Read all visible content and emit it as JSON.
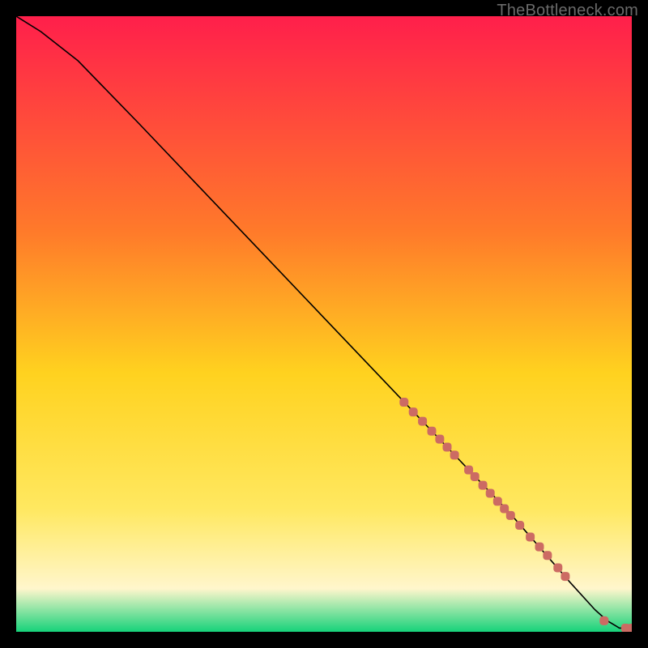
{
  "watermark": "TheBottleneck.com",
  "colors": {
    "background": "#000000",
    "gradient_top": "#ff1f4b",
    "gradient_mid_upper": "#ff7a2a",
    "gradient_mid": "#ffd21f",
    "gradient_mid_lower": "#ffe860",
    "gradient_pale": "#fff6cc",
    "gradient_bottom": "#16d27a",
    "curve": "#000000",
    "marker_fill": "#cc6b63",
    "marker_stroke": "#cc6b63"
  },
  "chart_data": {
    "type": "line",
    "title": "",
    "xlabel": "",
    "ylabel": "",
    "xlim": [
      0,
      100
    ],
    "ylim": [
      0,
      100
    ],
    "grid": false,
    "legend": false,
    "series": [
      {
        "name": "curve",
        "kind": "line",
        "x": [
          0,
          4,
          10,
          20,
          30,
          40,
          50,
          60,
          70,
          80,
          90,
          94,
          96,
          98,
          100
        ],
        "y": [
          100,
          97.5,
          92.8,
          82.5,
          72.0,
          61.5,
          51.0,
          40.5,
          30.0,
          19.5,
          8.0,
          3.6,
          1.8,
          0.6,
          0.6
        ]
      },
      {
        "name": "markers",
        "kind": "scatter",
        "x": [
          63,
          64.5,
          66,
          67.5,
          68.8,
          70,
          71.2,
          73.5,
          74.5,
          75.8,
          77,
          78.2,
          79.3,
          80.3,
          81.8,
          83.5,
          85,
          86.3,
          88,
          89.2,
          95.5,
          99,
          100
        ],
        "y": [
          37.3,
          35.7,
          34.2,
          32.6,
          31.3,
          30.0,
          28.7,
          26.3,
          25.2,
          23.8,
          22.5,
          21.2,
          20.0,
          18.9,
          17.3,
          15.4,
          13.8,
          12.4,
          10.4,
          9.0,
          1.8,
          0.6,
          0.6
        ]
      }
    ]
  }
}
